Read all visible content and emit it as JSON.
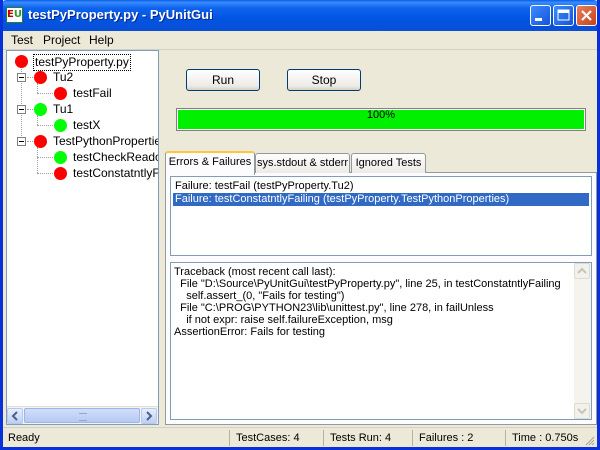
{
  "window": {
    "title": "testPyProperty.py - PyUnitGui"
  },
  "menu": [
    {
      "label": "Test"
    },
    {
      "label": "Project"
    },
    {
      "label": "Help"
    }
  ],
  "tree": [
    {
      "label": "testPyProperty.py",
      "status": "red"
    },
    {
      "label": "Tu2",
      "status": "red"
    },
    {
      "label": "testFail",
      "status": "red"
    },
    {
      "label": "Tu1",
      "status": "green"
    },
    {
      "label": "testX",
      "status": "green"
    },
    {
      "label": "TestPythonProperties",
      "status": "red"
    },
    {
      "label": "testCheckReadonly",
      "status": "green"
    },
    {
      "label": "testConstatntlyFailing",
      "status": "red"
    }
  ],
  "buttons": {
    "run": "Run",
    "stop": "Stop"
  },
  "progress": {
    "label": "100%",
    "fraction": 1.0,
    "color": "#00f000"
  },
  "tabs": [
    {
      "label": "Errors & Failures"
    },
    {
      "label": "sys.stdout & stderr"
    },
    {
      "label": "Ignored Tests"
    }
  ],
  "errors": [
    "Failure: testFail (testPyProperty.Tu2)",
    "Failure: testConstatntlyFailing (testPyProperty.TestPythonProperties)"
  ],
  "traceback": [
    "Traceback (most recent call last):",
    "  File \"D:\\Source\\PyUnitGui\\testPyProperty.py\", line 25, in testConstatntlyFailing",
    "    self.assert_(0, \"Fails for testing\")",
    "  File \"C:\\PROG\\PYTHON23\\lib\\unittest.py\", line 278, in failUnless",
    "    if not expr: raise self.failureException, msg",
    "AssertionError: Fails for testing"
  ],
  "status": {
    "ready": "Ready",
    "testcases": "TestCases: 4",
    "testsrun": "Tests Run: 4",
    "failures": "Failures : 2",
    "time": "Time : 0.750s"
  },
  "colors": {
    "pass": "#00ff00",
    "fail": "#ff0000",
    "selection": "#316ac5"
  }
}
